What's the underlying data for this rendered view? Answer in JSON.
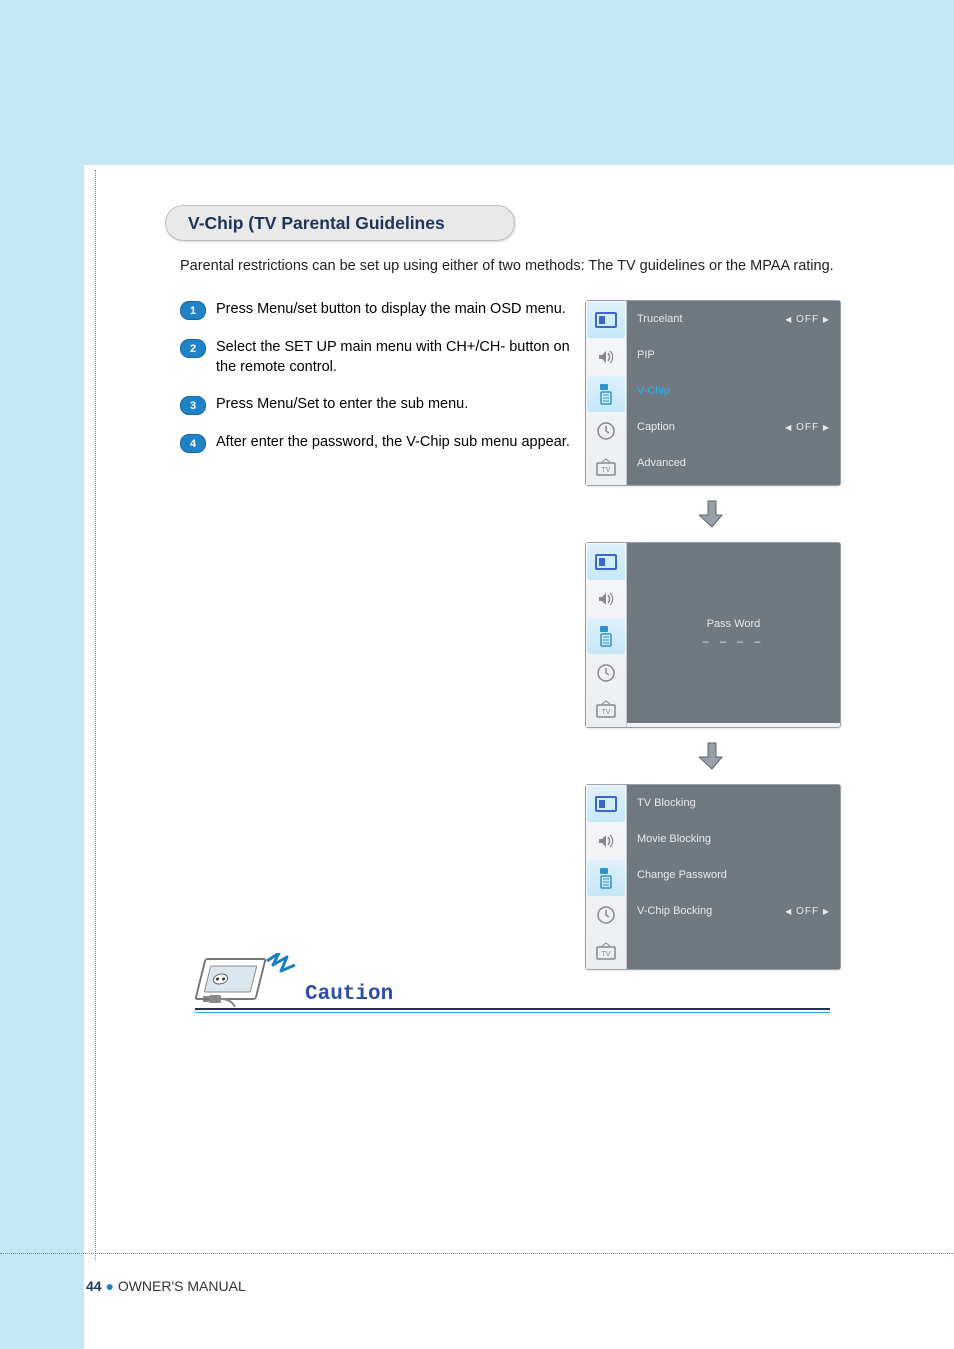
{
  "section_title": "V-Chip (TV Parental Guidelines",
  "intro": "Parental restrictions can be set up using either of two methods: The TV guidelines or the MPAA rating.",
  "steps": [
    "Press Menu/set button to display the main OSD menu.",
    "Select the SET UP main menu with CH+/CH- button on the remote control.",
    "Press Menu/Set to enter the sub menu.",
    "After enter the password, the V-Chip sub menu appear."
  ],
  "label_off_prefix": "◀",
  "label_off_text": "OFF",
  "label_off_suffix": "▶",
  "panel1": {
    "rows": [
      {
        "label": "Trucelant",
        "off": true,
        "selected": false
      },
      {
        "label": "PIP",
        "off": false,
        "selected": false
      },
      {
        "label": "V-Chip",
        "off": false,
        "selected": true
      },
      {
        "label": "Caption",
        "off": true,
        "selected": false
      },
      {
        "label": "Advanced",
        "off": false,
        "selected": false
      }
    ]
  },
  "panel2": {
    "title": "Pass Word",
    "placeholder": "– – – –"
  },
  "panel3": {
    "rows": [
      {
        "label": "TV Blocking",
        "off": false
      },
      {
        "label": "Movie Blocking",
        "off": false
      },
      {
        "label": "Change Password",
        "off": false
      },
      {
        "label": "V-Chip Bocking",
        "off": true
      }
    ]
  },
  "caution_label": "Caution",
  "page_number": "44",
  "footer_text": "OWNER'S MANUAL"
}
